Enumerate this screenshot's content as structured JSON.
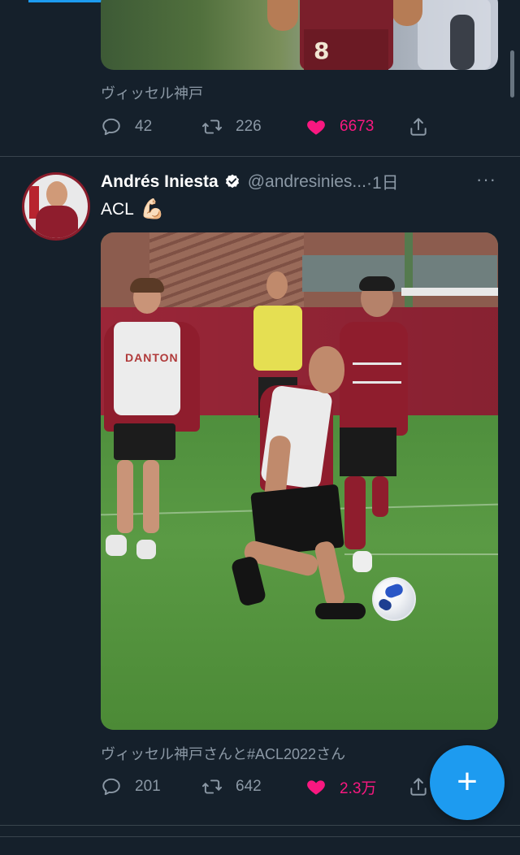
{
  "previous_tweet": {
    "jersey_number": "8",
    "social_context": "ヴィッセル神戸",
    "actions": {
      "replies": "42",
      "retweets": "226",
      "likes": "6673"
    }
  },
  "tweet": {
    "display_name": "Andrés Iniesta",
    "handle": "@andresinies...",
    "time": "·1日",
    "more": "···",
    "text": "ACL",
    "emoji": "💪🏻",
    "media": {
      "bib_text": "DANTON"
    },
    "social_context": "ヴィッセル神戸さんと#ACL2022さん",
    "actions": {
      "replies": "201",
      "retweets": "642",
      "likes": "2.3万"
    }
  },
  "fab": {
    "label": "+"
  },
  "colors": {
    "background": "#15202b",
    "muted_text": "#8b98a5",
    "like_pink": "#f91880",
    "accent_blue": "#1d9bf0",
    "divider": "#38444d"
  },
  "icons": {
    "reply": "reply-icon",
    "retweet": "retweet-icon",
    "like": "heart-icon",
    "share": "share-icon",
    "verified": "verified-badge-icon",
    "compose": "plus-icon"
  }
}
